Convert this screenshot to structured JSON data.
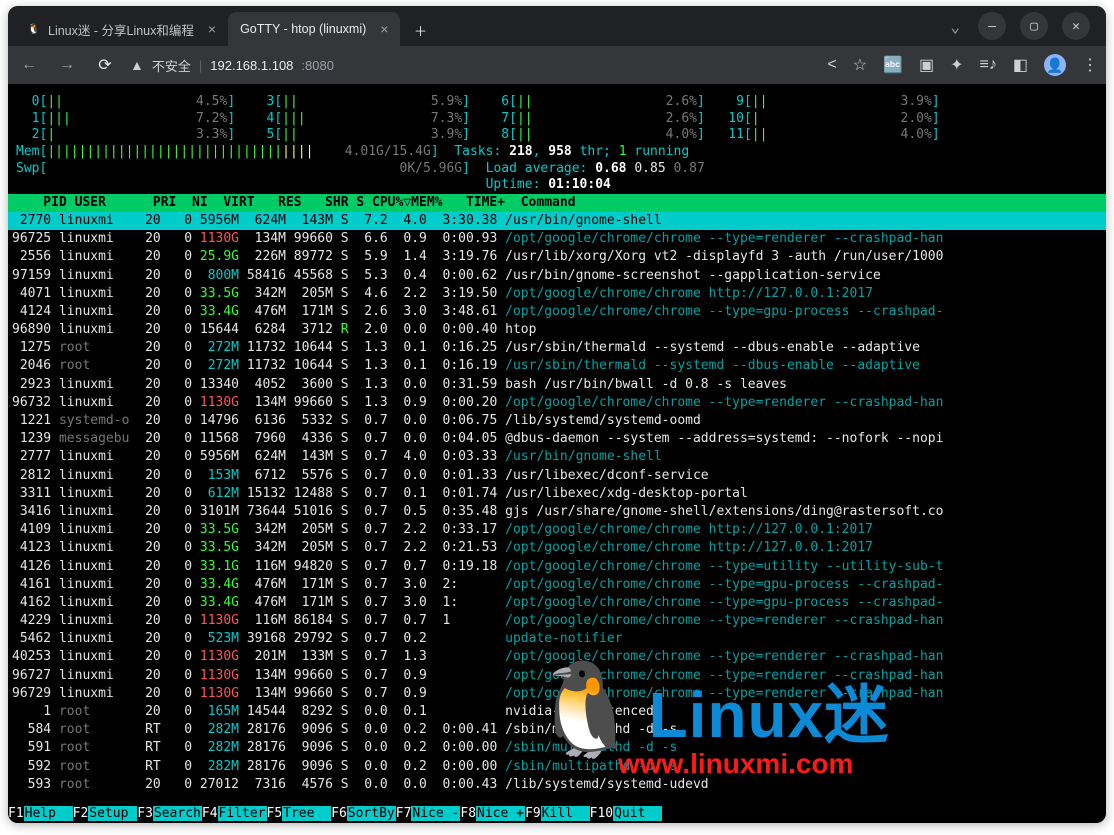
{
  "window": {
    "tabs": [
      {
        "title": "Linux迷 - 分享Linux和编程",
        "active": false
      },
      {
        "title": "GoTTY - htop (linuxmi)",
        "active": true
      }
    ],
    "url_prefix": "不安全",
    "url_host": "192.168.1.108",
    "url_port": ":8080"
  },
  "cpu_bars": [
    {
      "id": "0",
      "pct": "4.5%",
      "pos": 0
    },
    {
      "id": "1",
      "pct": "7.2%",
      "pos": 0
    },
    {
      "id": "2",
      "pct": "3.3%",
      "pos": 0
    },
    {
      "id": "3",
      "pct": "5.9%",
      "pos": 1
    },
    {
      "id": "4",
      "pct": "7.3%",
      "pos": 1
    },
    {
      "id": "5",
      "pct": "3.9%",
      "pos": 1
    },
    {
      "id": "6",
      "pct": "2.6%",
      "pos": 2
    },
    {
      "id": "7",
      "pct": "2.6%",
      "pos": 2
    },
    {
      "id": "8",
      "pct": "4.0%",
      "pos": 2
    },
    {
      "id": "9",
      "pct": "3.9%",
      "pos": 3
    },
    {
      "id": "10",
      "pct": "2.0%",
      "pos": 3
    },
    {
      "id": "11",
      "pct": "4.0%",
      "pos": 3
    }
  ],
  "mem": {
    "label": "Mem",
    "used": "4.01G",
    "total": "15.4G"
  },
  "swp": {
    "label": "Swp",
    "used": "0K",
    "total": "5.96G"
  },
  "summary": {
    "tasks_label": "Tasks:",
    "tasks": "218",
    "threads": "958",
    "thr": "thr;",
    "running": "1",
    "running_lbl": "running",
    "la_label": "Load average:",
    "la1": "0.68",
    "la2": "0.85",
    "la3": "0.87",
    "uptime_label": "Uptime:",
    "uptime": "01:10:04"
  },
  "columns": "    PID USER      PRI  NI  VIRT   RES   SHR S CPU%▽MEM%   TIME+  Command",
  "processes": [
    {
      "sel": true,
      "pid": " 2770",
      "user": "linuxmi",
      "pri": "20",
      "ni": "  0",
      "virt": "5956M",
      "res": " 624M",
      "shr": " 143M",
      "s": "S",
      "cpu": " 7.2",
      "mem": " 4.0",
      "time": " 3:30.38",
      "cmd": "/usr/bin/gnome-shell",
      "cmdc": "white"
    },
    {
      "pid": "96725",
      "user": "linuxmi",
      "pri": "20",
      "ni": "  0",
      "virt": "1130G",
      "vc": "red",
      "res": " 134M",
      "shr": "99660",
      "s": "S",
      "cpu": " 6.6",
      "mem": " 0.9",
      "time": " 0:00.93",
      "cmd": "/opt/google/chrome/chrome --type=renderer --crashpad-han",
      "cmdc": "teal"
    },
    {
      "pid": " 2556",
      "user": "linuxmi",
      "pri": "20",
      "ni": "  0",
      "virt": "25.9G",
      "vc": "green",
      "res": " 226M",
      "shr": "89772",
      "s": "S",
      "cpu": " 5.9",
      "mem": " 1.4",
      "time": " 3:19.76",
      "cmd": "/usr/lib/xorg/Xorg vt2 -displayfd 3 -auth /run/user/1000",
      "cmdc": "white"
    },
    {
      "pid": "97159",
      "user": "linuxmi",
      "pri": "20",
      "ni": "  0",
      "virt": " 800M",
      "vc": "cyan",
      "res": "58416",
      "shr": "45568",
      "s": "S",
      "cpu": " 5.3",
      "mem": " 0.4",
      "time": " 0:00.62",
      "cmd": "/usr/bin/gnome-screenshot --gapplication-service",
      "cmdc": "white"
    },
    {
      "pid": " 4071",
      "user": "linuxmi",
      "pri": "20",
      "ni": "  0",
      "virt": "33.5G",
      "vc": "green",
      "res": " 342M",
      "shr": " 205M",
      "s": "S",
      "cpu": " 4.6",
      "mem": " 2.2",
      "time": " 3:19.50",
      "cmd": "/opt/google/chrome/chrome http://127.0.0.1:2017",
      "cmdc": "teal"
    },
    {
      "pid": " 4124",
      "user": "linuxmi",
      "pri": "20",
      "ni": "  0",
      "virt": "33.4G",
      "vc": "green",
      "res": " 476M",
      "shr": " 171M",
      "s": "S",
      "cpu": " 2.6",
      "mem": " 3.0",
      "time": " 3:48.61",
      "cmd": "/opt/google/chrome/chrome --type=gpu-process --crashpad-",
      "cmdc": "teal"
    },
    {
      "pid": "96890",
      "user": "linuxmi",
      "pri": "20",
      "ni": "  0",
      "virt": "15644",
      "res": " 6284",
      "shr": " 3712",
      "s": "R",
      "sc": "green",
      "cpu": " 2.0",
      "mem": " 0.0",
      "time": " 0:00.40",
      "cmd": "htop",
      "cmdc": "white"
    },
    {
      "pid": " 1275",
      "user": "root",
      "uc": "grey",
      "pri": "20",
      "ni": "  0",
      "virt": " 272M",
      "vc": "cyan",
      "res": "11732",
      "shr": "10644",
      "s": "S",
      "cpu": " 1.3",
      "mem": " 0.1",
      "time": " 0:16.25",
      "cmd": "/usr/sbin/thermald --systemd --dbus-enable --adaptive",
      "cmdc": "white"
    },
    {
      "pid": " 2046",
      "user": "root",
      "uc": "grey",
      "pri": "20",
      "ni": "  0",
      "virt": " 272M",
      "vc": "cyan",
      "res": "11732",
      "shr": "10644",
      "s": "S",
      "cpu": " 1.3",
      "mem": " 0.1",
      "time": " 0:16.19",
      "cmd": "/usr/sbin/thermald --systemd --dbus-enable --adaptive",
      "cmdc": "teal"
    },
    {
      "pid": " 2923",
      "user": "linuxmi",
      "pri": "20",
      "ni": "  0",
      "virt": "13340",
      "res": " 4052",
      "shr": " 3600",
      "s": "S",
      "cpu": " 1.3",
      "mem": " 0.0",
      "time": " 0:31.59",
      "cmd": "bash /usr/bin/bwall -d 0.8 -s leaves",
      "cmdc": "white"
    },
    {
      "pid": "96732",
      "user": "linuxmi",
      "pri": "20",
      "ni": "  0",
      "virt": "1130G",
      "vc": "red",
      "res": " 134M",
      "shr": "99660",
      "s": "S",
      "cpu": " 1.3",
      "mem": " 0.9",
      "time": " 0:00.20",
      "cmd": "/opt/google/chrome/chrome --type=renderer --crashpad-han",
      "cmdc": "teal"
    },
    {
      "pid": " 1221",
      "user": "systemd-o",
      "uc": "grey",
      "pri": "20",
      "ni": "  0",
      "virt": "14796",
      "res": " 6136",
      "shr": " 5332",
      "s": "S",
      "cpu": " 0.7",
      "mem": " 0.0",
      "time": " 0:06.75",
      "cmd": "/lib/systemd/systemd-oomd",
      "cmdc": "white"
    },
    {
      "pid": " 1239",
      "user": "messagebu",
      "uc": "grey",
      "pri": "20",
      "ni": "  0",
      "virt": "11568",
      "res": " 7960",
      "shr": " 4336",
      "s": "S",
      "cpu": " 0.7",
      "mem": " 0.0",
      "time": " 0:04.05",
      "cmd": "@dbus-daemon --system --address=systemd: --nofork --nopi",
      "cmdc": "white"
    },
    {
      "pid": " 2777",
      "user": "linuxmi",
      "pri": "20",
      "ni": "  0",
      "virt": "5956M",
      "res": " 624M",
      "shr": " 143M",
      "s": "S",
      "cpu": " 0.7",
      "mem": " 4.0",
      "time": " 0:03.33",
      "cmd": "/usr/bin/gnome-shell",
      "cmdc": "teal"
    },
    {
      "pid": " 2812",
      "user": "linuxmi",
      "pri": "20",
      "ni": "  0",
      "virt": " 153M",
      "vc": "cyan",
      "res": " 6712",
      "shr": " 5576",
      "s": "S",
      "cpu": " 0.7",
      "mem": " 0.0",
      "time": " 0:01.33",
      "cmd": "/usr/libexec/dconf-service",
      "cmdc": "white"
    },
    {
      "pid": " 3311",
      "user": "linuxmi",
      "pri": "20",
      "ni": "  0",
      "virt": " 612M",
      "vc": "cyan",
      "res": "15132",
      "shr": "12488",
      "s": "S",
      "cpu": " 0.7",
      "mem": " 0.1",
      "time": " 0:01.74",
      "cmd": "/usr/libexec/xdg-desktop-portal",
      "cmdc": "white"
    },
    {
      "pid": " 3416",
      "user": "linuxmi",
      "pri": "20",
      "ni": "  0",
      "virt": "3101M",
      "res": "73644",
      "shr": "51016",
      "s": "S",
      "cpu": " 0.7",
      "mem": " 0.5",
      "time": " 0:35.48",
      "cmd": "gjs /usr/share/gnome-shell/extensions/ding@rastersoft.co",
      "cmdc": "white"
    },
    {
      "pid": " 4109",
      "user": "linuxmi",
      "pri": "20",
      "ni": "  0",
      "virt": "33.5G",
      "vc": "green",
      "res": " 342M",
      "shr": " 205M",
      "s": "S",
      "cpu": " 0.7",
      "mem": " 2.2",
      "time": " 0:33.17",
      "cmd": "/opt/google/chrome/chrome http://127.0.0.1:2017",
      "cmdc": "teal"
    },
    {
      "pid": " 4123",
      "user": "linuxmi",
      "pri": "20",
      "ni": "  0",
      "virt": "33.5G",
      "vc": "green",
      "res": " 342M",
      "shr": " 205M",
      "s": "S",
      "cpu": " 0.7",
      "mem": " 2.2",
      "time": " 0:21.53",
      "cmd": "/opt/google/chrome/chrome http://127.0.0.1:2017",
      "cmdc": "teal"
    },
    {
      "pid": " 4126",
      "user": "linuxmi",
      "pri": "20",
      "ni": "  0",
      "virt": "33.1G",
      "vc": "green",
      "res": " 116M",
      "shr": "94820",
      "s": "S",
      "cpu": " 0.7",
      "mem": " 0.7",
      "time": " 0:19.18",
      "cmd": "/opt/google/chrome/chrome --type=utility --utility-sub-t",
      "cmdc": "teal"
    },
    {
      "pid": " 4161",
      "user": "linuxmi",
      "pri": "20",
      "ni": "  0",
      "virt": "33.4G",
      "vc": "green",
      "res": " 476M",
      "shr": " 171M",
      "s": "S",
      "cpu": " 0.7",
      "mem": " 3.0",
      "time": " 2:     ",
      "cmd": "/opt/google/chrome/chrome --type=gpu-process --crashpad-",
      "cmdc": "teal"
    },
    {
      "pid": " 4162",
      "user": "linuxmi",
      "pri": "20",
      "ni": "  0",
      "virt": "33.4G",
      "vc": "green",
      "res": " 476M",
      "shr": " 171M",
      "s": "S",
      "cpu": " 0.7",
      "mem": " 3.0",
      "time": " 1:     ",
      "cmd": "/opt/google/chrome/chrome --type=gpu-process --crashpad-",
      "cmdc": "teal"
    },
    {
      "pid": " 4229",
      "user": "linuxmi",
      "pri": "20",
      "ni": "  0",
      "virt": "1130G",
      "vc": "red",
      "res": " 116M",
      "shr": "86184",
      "s": "S",
      "cpu": " 0.7",
      "mem": " 0.7",
      "time": " 1      ",
      "cmd": "/opt/google/chrome/chrome --type=renderer --crashpad-han",
      "cmdc": "teal"
    },
    {
      "pid": " 5462",
      "user": "linuxmi",
      "pri": "20",
      "ni": "  0",
      "virt": " 523M",
      "vc": "cyan",
      "res": "39168",
      "shr": "29792",
      "s": "S",
      "cpu": " 0.7",
      "mem": " 0.2",
      "time": "       ",
      "cmd": "update-notifier",
      "cmdc": "teal"
    },
    {
      "pid": "40253",
      "user": "linuxmi",
      "pri": "20",
      "ni": "  0",
      "virt": "1130G",
      "vc": "red",
      "res": " 201M",
      "shr": " 133M",
      "s": "S",
      "cpu": " 0.7",
      "mem": " 1.3",
      "time": "       ",
      "cmd": "/opt/google/chrome/chrome --type=renderer --crashpad-han",
      "cmdc": "teal"
    },
    {
      "pid": "96727",
      "user": "linuxmi",
      "pri": "20",
      "ni": "  0",
      "virt": "1130G",
      "vc": "red",
      "res": " 134M",
      "shr": "99660",
      "s": "S",
      "cpu": " 0.7",
      "mem": " 0.9",
      "time": "       ",
      "cmd": "/opt/google/chrome/chrome --type=renderer --crashpad-han",
      "cmdc": "teal"
    },
    {
      "pid": "96729",
      "user": "linuxmi",
      "pri": "20",
      "ni": "  0",
      "virt": "1130G",
      "vc": "red",
      "res": " 134M",
      "shr": "99660",
      "s": "S",
      "cpu": " 0.7",
      "mem": " 0.9",
      "time": "       ",
      "cmd": "/opt/google/chrome/chrome --type=renderer --crashpad-han",
      "cmdc": "teal"
    },
    {
      "pid": "    1",
      "user": "root",
      "uc": "grey",
      "pri": "20",
      "ni": "  0",
      "virt": " 165M",
      "vc": "cyan",
      "res": "14544",
      "shr": " 8292",
      "s": "S",
      "cpu": " 0.0",
      "mem": " 0.1",
      "time": "       ",
      "cmd": "nvidia-persistenced",
      "cmdc": "white"
    },
    {
      "pid": "  584",
      "user": "root",
      "uc": "grey",
      "pri": "RT",
      "ni": "  0",
      "virt": " 282M",
      "vc": "cyan",
      "res": "28176",
      "shr": " 9096",
      "s": "S",
      "cpu": " 0.0",
      "mem": " 0.2",
      "time": " 0:00.41",
      "cmd": "/sbin/multipathd -d -s",
      "cmdc": "white"
    },
    {
      "pid": "  591",
      "user": "root",
      "uc": "grey",
      "pri": "RT",
      "ni": "  0",
      "virt": " 282M",
      "vc": "cyan",
      "res": "28176",
      "shr": " 9096",
      "s": "S",
      "cpu": " 0.0",
      "mem": " 0.2",
      "time": " 0:00.00",
      "cmd": "/sbin/multipathd -d -s",
      "cmdc": "teal"
    },
    {
      "pid": "  592",
      "user": "root",
      "uc": "grey",
      "pri": "RT",
      "ni": "  0",
      "virt": " 282M",
      "vc": "cyan",
      "res": "28176",
      "shr": " 9096",
      "s": "S",
      "cpu": " 0.0",
      "mem": " 0.2",
      "time": " 0:00.00",
      "cmd": "/sbin/multipathd -d -s",
      "cmdc": "teal"
    },
    {
      "pid": "  593",
      "user": "root",
      "uc": "grey",
      "pri": "20",
      "ni": "  0",
      "virt": "27012",
      "res": " 7316",
      "shr": " 4576",
      "s": "S",
      "cpu": " 0.0",
      "mem": " 0.0",
      "time": " 0:00.43",
      "cmd": "/lib/systemd/systemd-udevd",
      "cmdc": "white"
    }
  ],
  "fkeys": [
    {
      "k": "F1",
      "v": "Help  "
    },
    {
      "k": "F2",
      "v": "Setup "
    },
    {
      "k": "F3",
      "v": "Search"
    },
    {
      "k": "F4",
      "v": "Filter"
    },
    {
      "k": "F5",
      "v": "Tree  "
    },
    {
      "k": "F6",
      "v": "SortBy"
    },
    {
      "k": "F7",
      "v": "Nice -"
    },
    {
      "k": "F8",
      "v": "Nice +"
    },
    {
      "k": "F9",
      "v": "Kill  "
    },
    {
      "k": "F10",
      "v": "Quit  "
    }
  ],
  "watermark": {
    "text": "Linux迷",
    "url": "www.linuxmi.com"
  }
}
